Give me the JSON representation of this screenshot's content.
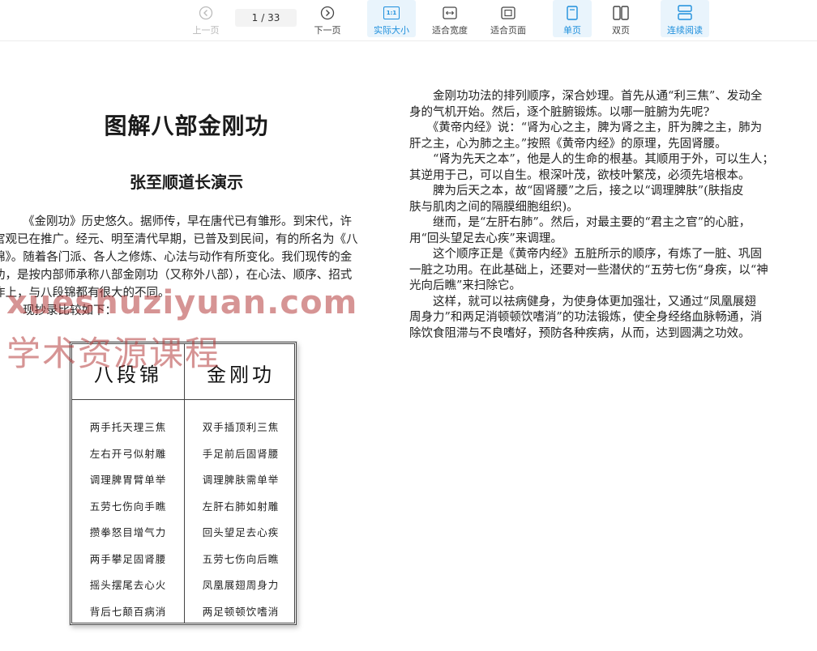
{
  "toolbar": {
    "prev_label": "上一页",
    "page_current": "1",
    "page_total": "/ 33",
    "next_label": "下一页",
    "actual_size_label": "实际大小",
    "actual_size_icon_text": "1:1",
    "fit_width_label": "适合宽度",
    "fit_page_label": "适合页面",
    "single_page_label": "单页",
    "double_page_label": "双页",
    "continuous_label": "连续阅读",
    "accent_color": "#1e8fdc"
  },
  "left_page": {
    "title": "图解八部金刚功",
    "subtitle": "张至顺道长演示",
    "paragraph_lines": [
      "《金刚功》历史悠久。据师传，早在唐代已有雏形。到宋代，许",
      "宫观已在推广。经元、明至清代早期，已普及到民间，有的所名为《八",
      "锦》。随着各门派、各人之修炼、心法与动作有所变化。我们现传的金",
      "功，是按内部师承称八部金刚功（又称外八部），在心法、顺序、招式",
      "作上，与八段锦都有很大的不同。",
      "现抄录比较如下："
    ],
    "table": {
      "left_header": "八段锦",
      "right_header": "金刚功",
      "left_items": [
        "两手托天理三焦",
        "左右开弓似射雕",
        "调理脾胃臂单举",
        "五劳七伤向手瞧",
        "攒拳怒目增气力",
        "两手攀足固肾腰",
        "摇头摆尾去心火",
        "背后七颠百病消"
      ],
      "right_items": [
        "双手插顶利三焦",
        "手足前后固肾腰",
        "调理脾肤需单举",
        "左肝右肺如射雕",
        "回头望足去心疾",
        "五劳七伤向后瞧",
        "凤凰展翅周身力",
        "两足顿顿饮嗜消"
      ]
    }
  },
  "right_page": {
    "lines": [
      "　　金刚功功法的排列顺序，深合妙理。首先从通“利三焦”、发动全",
      "身的气机开始。然后，逐个脏腑锻炼。以哪一脏腑为先呢?",
      "　　《黄帝内经》说：“肾为心之主，脾为肾之主，肝为脾之主，肺为",
      "肝之主，心为肺之主。”按照《黄帝内经》的原理，先固肾腰。",
      "　　“肾为先天之本”，他是人的生命的根基。其顺用于外，可以生人；",
      "其逆用于己，可以自生。根深叶茂，欲枝叶繁茂，必须先培根本。",
      "　　脾为后天之本，故“固肾腰”之后，接之以“调理脾肤”(肤指皮",
      "肤与肌肉之间的隔膜细胞组织)。",
      "　　继而，是“左肝右肺”。然后，对最主要的“君主之官”的心脏，",
      "用“回头望足去心疾”来调理。",
      "　　这个顺序正是《黄帝内经》五脏所示的顺序，有炼了一脏、巩固",
      "一脏之功用。在此基础上，还要对一些潜伏的“五劳七伤“身疾，以“神",
      "光向后瞧”来扫除它。",
      "　　这样，就可以祛病健身，为使身体更加强壮，又通过“凤凰展翅",
      "周身力”和两足消顿顿饮嗜消”的功法锻炼，使全身经络血脉畅通，消",
      "除饮食阻滞与不良嗜好，预防各种疾病，从而，达到圆满之功效。"
    ]
  },
  "watermark": {
    "url": "xueshuziyuan.com",
    "chinese": "学术资源课程"
  }
}
